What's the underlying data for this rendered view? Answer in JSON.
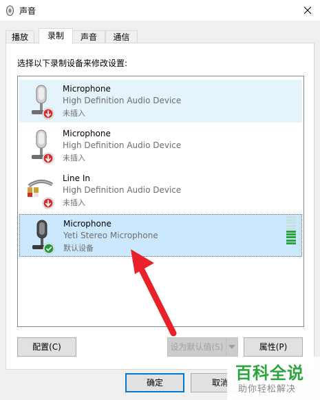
{
  "window": {
    "title": "声音"
  },
  "tabs": [
    {
      "label": "播放"
    },
    {
      "label": "录制"
    },
    {
      "label": "声音"
    },
    {
      "label": "通信"
    }
  ],
  "active_tab": "录制",
  "instruction": "选择以下录制设备来修改设置:",
  "devices": [
    {
      "name": "Microphone",
      "description": "High Definition Audio Device",
      "status": "未插入",
      "icon": "microphone-icon",
      "badge": "unplugged-red-arrow-icon"
    },
    {
      "name": "Microphone",
      "description": "High Definition Audio Device",
      "status": "未插入",
      "icon": "microphone-icon",
      "badge": "unplugged-red-arrow-icon"
    },
    {
      "name": "Line In",
      "description": "High Definition Audio Device",
      "status": "未插入",
      "icon": "line-in-cable-icon",
      "badge": "unplugged-red-arrow-icon"
    },
    {
      "name": "Microphone",
      "description": "Yeti Stereo Microphone",
      "status": "默认设备",
      "icon": "microphone-icon",
      "badge": "default-green-check-icon"
    }
  ],
  "level_meter": {
    "lit_fraction": 0.5
  },
  "buttons": {
    "configure": "配置(C)",
    "set_default": "设为默认值(S)",
    "properties": "属性(P)",
    "ok": "确定",
    "cancel": "取消"
  },
  "watermark": {
    "main": "百科全说",
    "sub": "助你轻松解决"
  },
  "colors": {
    "selection": "#cce8ff",
    "hover": "#e5f3fb",
    "meter_lit": "#2aa33a",
    "annotation_arrow": "#e8212a",
    "watermark_green": "#2aa53a"
  }
}
